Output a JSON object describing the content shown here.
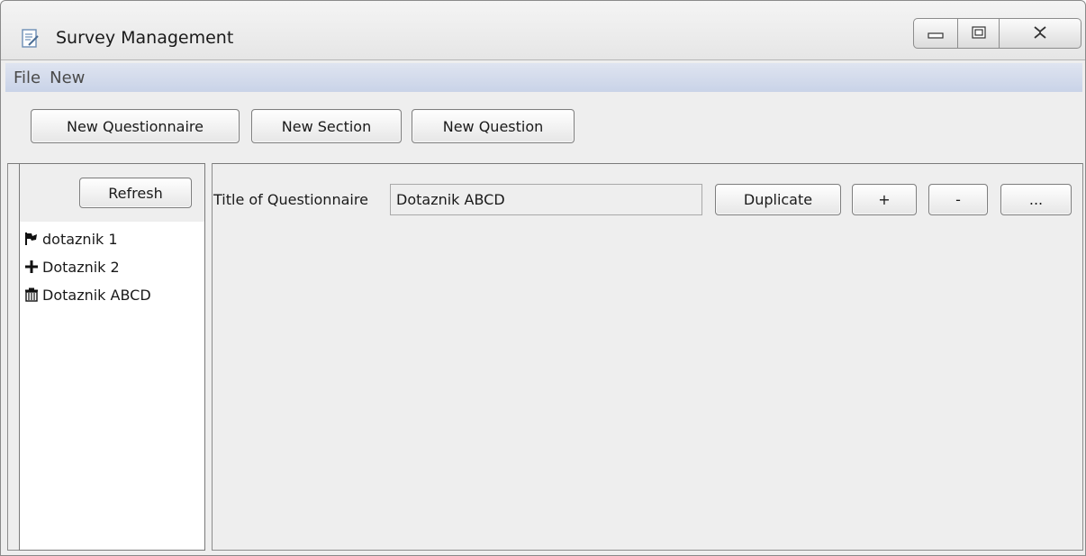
{
  "window": {
    "title": "Survey Management",
    "controls": [
      "minimize",
      "maximize",
      "close"
    ]
  },
  "menu": {
    "items": [
      "File",
      "New"
    ]
  },
  "toolbar": {
    "new_questionnaire": "New Questionnaire",
    "new_section": "New Section",
    "new_question": "New Question"
  },
  "sidebar": {
    "refresh_label": "Refresh",
    "items": [
      {
        "label": "dotaznik 1",
        "icon": "flag-icon"
      },
      {
        "label": "Dotaznik 2",
        "icon": "plus-icon"
      },
      {
        "label": "Dotaznik ABCD",
        "icon": "trash-icon"
      }
    ]
  },
  "form": {
    "title_label": "Title of Questionnaire",
    "title_value": "Dotaznik ABCD",
    "duplicate_label": "Duplicate",
    "add_label": "+",
    "remove_label": "-",
    "more_label": "..."
  }
}
